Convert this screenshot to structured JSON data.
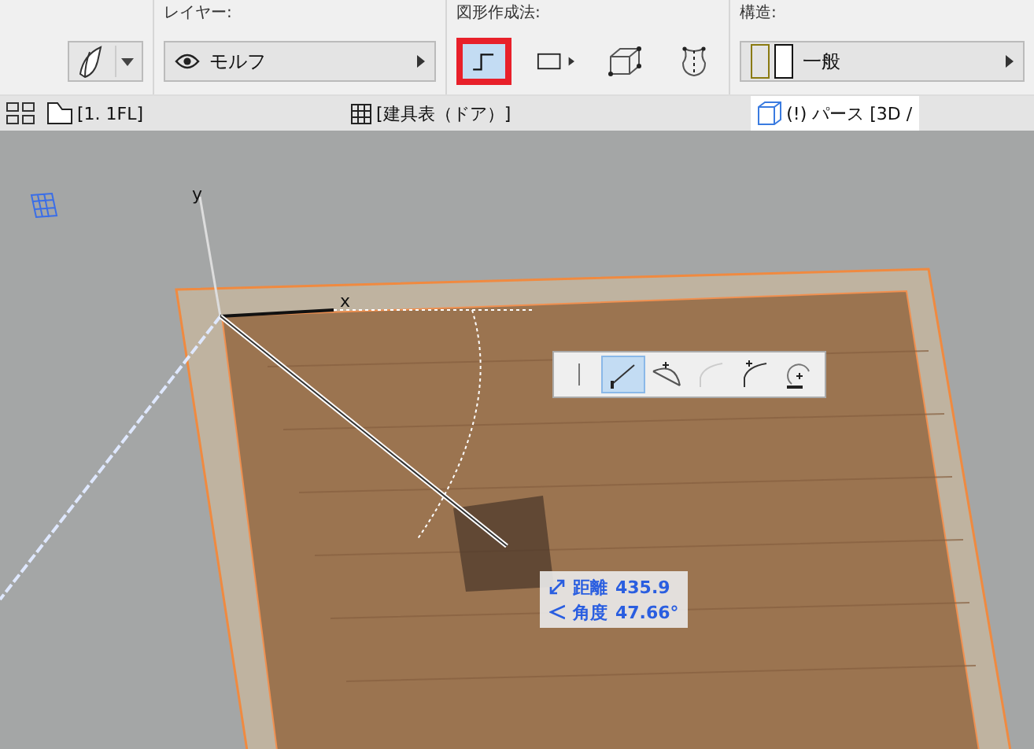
{
  "toolbar": {
    "layer": {
      "label": "レイヤー:",
      "value": "モルフ"
    },
    "geometry": {
      "label": "図形作成法:",
      "methods": [
        {
          "kind": "polyline",
          "selected": true
        },
        {
          "kind": "rect",
          "selected": false
        },
        {
          "kind": "box",
          "selected": false
        },
        {
          "kind": "revolve",
          "selected": false
        }
      ]
    },
    "structure": {
      "label": "構造:",
      "value": "一般"
    }
  },
  "tabs": [
    {
      "kind": "plan",
      "label": "[1. 1FL]",
      "selected": false
    },
    {
      "kind": "schedule",
      "label": "[建具表（ドア）]",
      "selected": false
    },
    {
      "kind": "perspective",
      "label": "(!) パース [3D /",
      "selected": true
    }
  ],
  "viewport": {
    "axes": {
      "x": "x",
      "y": "y"
    },
    "pet_palette": [
      {
        "kind": "line",
        "selected": false
      },
      {
        "kind": "segment",
        "selected": true
      },
      {
        "kind": "arc",
        "selected": false,
        "disabled": false
      },
      {
        "kind": "tangent",
        "selected": false,
        "disabled": true
      },
      {
        "kind": "tangent2",
        "selected": false,
        "disabled": false
      },
      {
        "kind": "circle",
        "selected": false,
        "disabled": false
      }
    ],
    "tracker": [
      {
        "kind": "distance",
        "label": "距離",
        "value": "435.9"
      },
      {
        "kind": "angle",
        "label": "角度",
        "value": "47.66°"
      }
    ]
  }
}
